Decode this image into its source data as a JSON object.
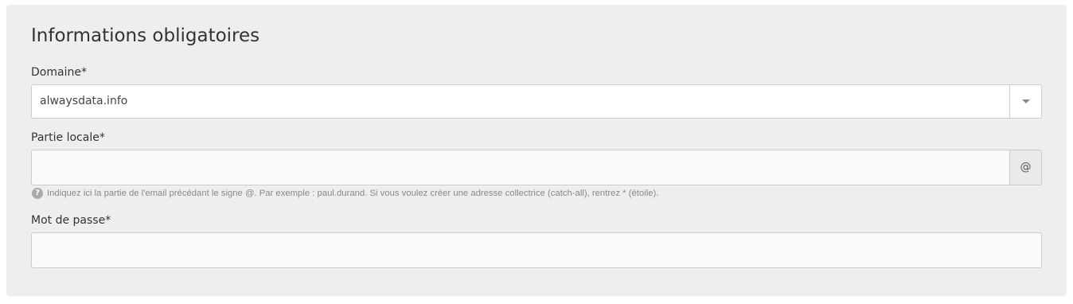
{
  "section": {
    "title": "Informations obligatoires"
  },
  "domain": {
    "label": "Domaine*",
    "value": "alwaysdata.info"
  },
  "local_part": {
    "label": "Partie locale*",
    "value": "",
    "addon": "@",
    "help_icon": "question-circle-icon",
    "help": "Indiquez ici la partie de l'email précédant le signe @. Par exemple : paul.durand. Si vous voulez créer une adresse collectrice (catch-all), rentrez * (étoile)."
  },
  "password": {
    "label": "Mot de passe*",
    "value": ""
  },
  "colors": {
    "panel_bg": "#eeeeee",
    "input_bg": "#fafafa",
    "border": "#cccccc",
    "text": "#333333",
    "help_text": "#888888"
  }
}
